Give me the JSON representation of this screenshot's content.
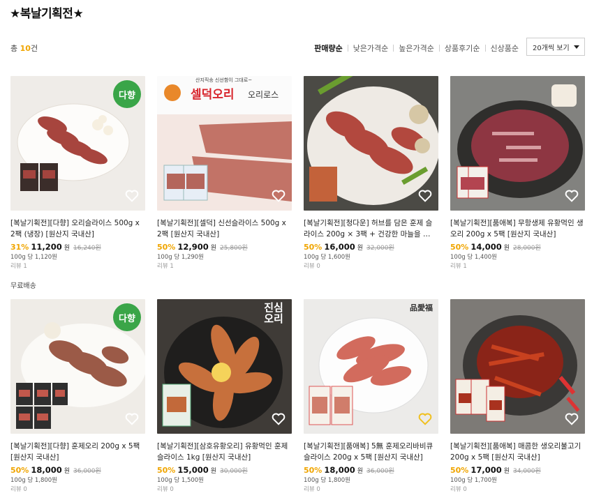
{
  "page_title": "★복날기획전★",
  "total": {
    "prefix": "총 ",
    "count": "10",
    "suffix": "건"
  },
  "sort_options": [
    "판매량순",
    "낮은가격순",
    "높은가격순",
    "상품후기순",
    "신상품순"
  ],
  "sort_active": "판매량순",
  "per_page": "20개씩 보기",
  "products": [
    {
      "title": "[복날기획전][다향] 오리슬라이스 500g x 2팩 (냉장) [원산지 국내산]",
      "rate": "31%",
      "price": "11,200",
      "won": "원",
      "orig": "16,240원",
      "unit": "100g 당 1,120원",
      "review": "리뷰 1",
      "shipping": "무료배송",
      "badge": "다향",
      "image": "duck-slices-plate"
    },
    {
      "title": "[복날기획전][셀덕] 신선슬라이스 500g x 2팩 [원산지 국내산]",
      "rate": "50%",
      "price": "12,900",
      "won": "원",
      "orig": "25,800원",
      "unit": "100g 당 1,290원",
      "review": "리뷰 1",
      "banner_small": "산지직송 신선함이 그대로~",
      "banner_brand": "셀덕오리",
      "banner_sub": "오리로스",
      "image": "raw-duck-slices"
    },
    {
      "title": "[복날기획전][청다운] 허브를 담은 훈제 슬라이스 200g × 3팩 + 건강한 마늘을 …",
      "rate": "50%",
      "price": "16,000",
      "won": "원",
      "orig": "32,000원",
      "unit": "100g 당 1,600원",
      "review": "리뷰 0",
      "image": "smoked-duck-garlic"
    },
    {
      "title": "[복날기획전][품애복] 무항생제 유황먹인 생오리 200g x 5팩 [원산지 국내산]",
      "rate": "50%",
      "price": "14,000",
      "won": "원",
      "orig": "28,000원",
      "unit": "100g 당 1,400원",
      "review": "리뷰 1",
      "image": "raw-duck-dark-plate"
    },
    {
      "title": "[복날기획전][다향] 훈제오리 200g x 5팩 [원산지 국내산]",
      "rate": "50%",
      "price": "18,000",
      "won": "원",
      "orig": "36,000원",
      "unit": "100g 당 1,800원",
      "review": "리뷰 0",
      "badge": "다향",
      "image": "smoked-duck-packs"
    },
    {
      "title": "[복날기획전][삼호유황오리] 유황먹인 훈제 슬라이스 1kg [원산지 국내산]",
      "rate": "50%",
      "price": "15,000",
      "won": "원",
      "orig": "30,000원",
      "unit": "100g 당 1,500원",
      "review": "리뷰 0",
      "banner_brand": "진심오리",
      "image": "smoked-duck-lemon"
    },
    {
      "title": "[복날기획전][품애복] 5無 훈제오리바비큐 슬라이스 200g x 5팩 [원산지 국내산]",
      "rate": "50%",
      "price": "18,000",
      "won": "원",
      "orig": "36,000원",
      "unit": "100g 당 1,800원",
      "review": "리뷰 0",
      "banner_brand": "品愛福",
      "image": "smoked-bbq-slices"
    },
    {
      "title": "[복날기획전][품애복] 매콤한 생오리불고기 200g x 5팩 [원산지 국내산]",
      "rate": "50%",
      "price": "17,000",
      "won": "원",
      "orig": "34,000원",
      "unit": "100g 당 1,700원",
      "review": "리뷰 0",
      "image": "spicy-duck-bulgogi"
    }
  ],
  "icons": {
    "wishlist": "heart-icon",
    "dropdown": "caret-down-icon"
  },
  "colors": {
    "accent": "#f0a500",
    "badge_green": "#3aa548"
  }
}
